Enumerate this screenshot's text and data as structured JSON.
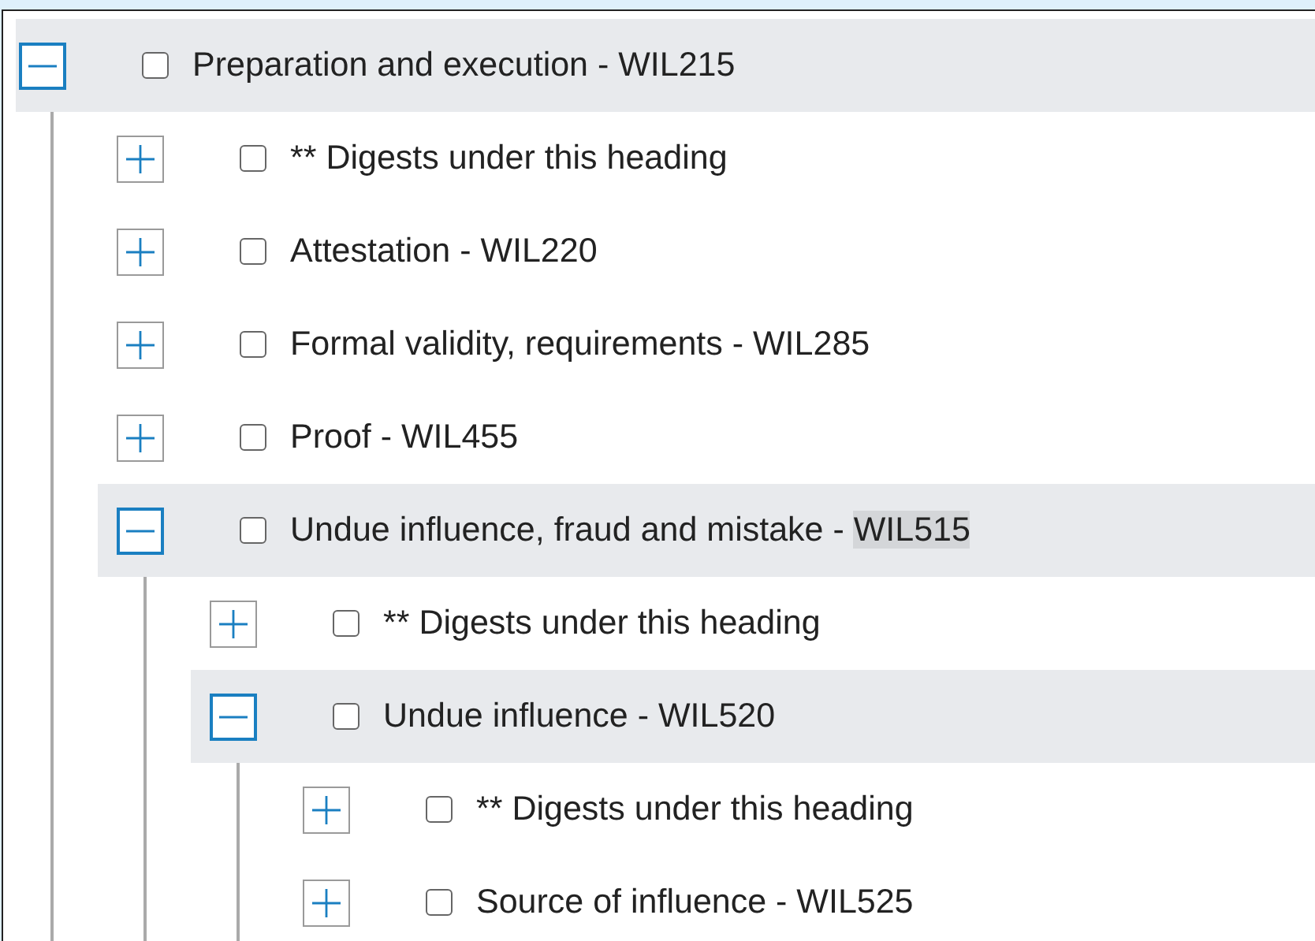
{
  "tree": [
    {
      "label": "Preparation and execution - ",
      "code": "WIL215",
      "code_highlighted": false,
      "expanded": true,
      "checked": false,
      "children": [
        {
          "label": "** Digests under this heading",
          "expanded": false,
          "checked": false
        },
        {
          "label": "Attestation - ",
          "code": "WIL220",
          "code_highlighted": false,
          "expanded": false,
          "checked": false
        },
        {
          "label": "Formal validity, requirements - ",
          "code": "WIL285",
          "code_highlighted": false,
          "expanded": false,
          "checked": false
        },
        {
          "label": "Proof - ",
          "code": "WIL455",
          "code_highlighted": false,
          "expanded": false,
          "checked": false
        },
        {
          "label": "Undue influence, fraud and mistake - ",
          "code": "WIL515",
          "code_highlighted": true,
          "expanded": true,
          "checked": false,
          "children": [
            {
              "label": "** Digests under this heading",
              "expanded": false,
              "checked": false
            },
            {
              "label": "Undue influence - ",
              "code": "WIL520",
              "code_highlighted": false,
              "expanded": true,
              "checked": false,
              "children": [
                {
                  "label": "** Digests under this heading",
                  "expanded": false,
                  "checked": false
                },
                {
                  "label": "Source of influence - ",
                  "code": "WIL525",
                  "code_highlighted": false,
                  "expanded": false,
                  "checked": false
                }
              ]
            }
          ]
        }
      ]
    }
  ]
}
